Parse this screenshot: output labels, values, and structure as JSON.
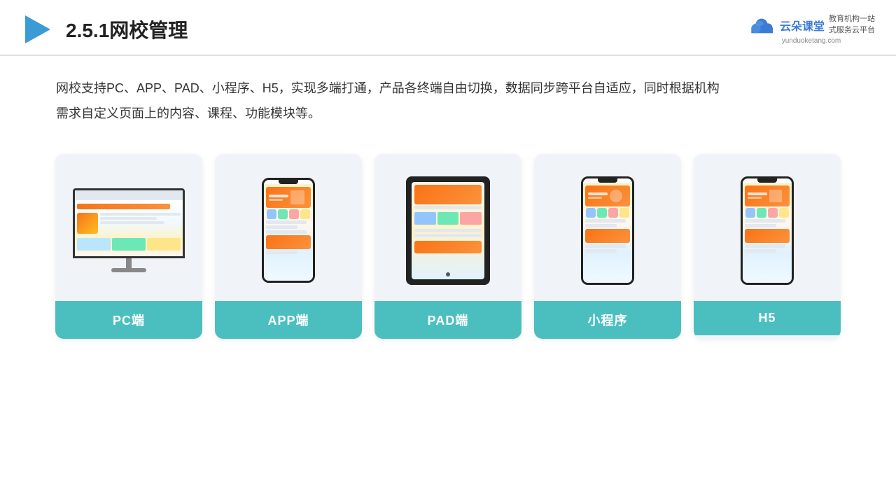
{
  "header": {
    "title": "2.5.1网校管理",
    "logo": {
      "name": "云朵课堂",
      "url": "yunduoketang.com",
      "tagline": "教育机构一站\n式服务云平台"
    }
  },
  "description": "网校支持PC、APP、PAD、小程序、H5，实现多端打通，产品各终端自由切换，数据同步跨平台自适应，同时根据机构\n需求自定义页面上的内容、课程、功能模块等。",
  "cards": [
    {
      "id": "pc",
      "label": "PC端"
    },
    {
      "id": "app",
      "label": "APP端"
    },
    {
      "id": "pad",
      "label": "PAD端"
    },
    {
      "id": "mini",
      "label": "小程序"
    },
    {
      "id": "h5",
      "label": "H5"
    }
  ],
  "colors": {
    "accent": "#4bbfbf",
    "title": "#222222",
    "text": "#333333"
  }
}
